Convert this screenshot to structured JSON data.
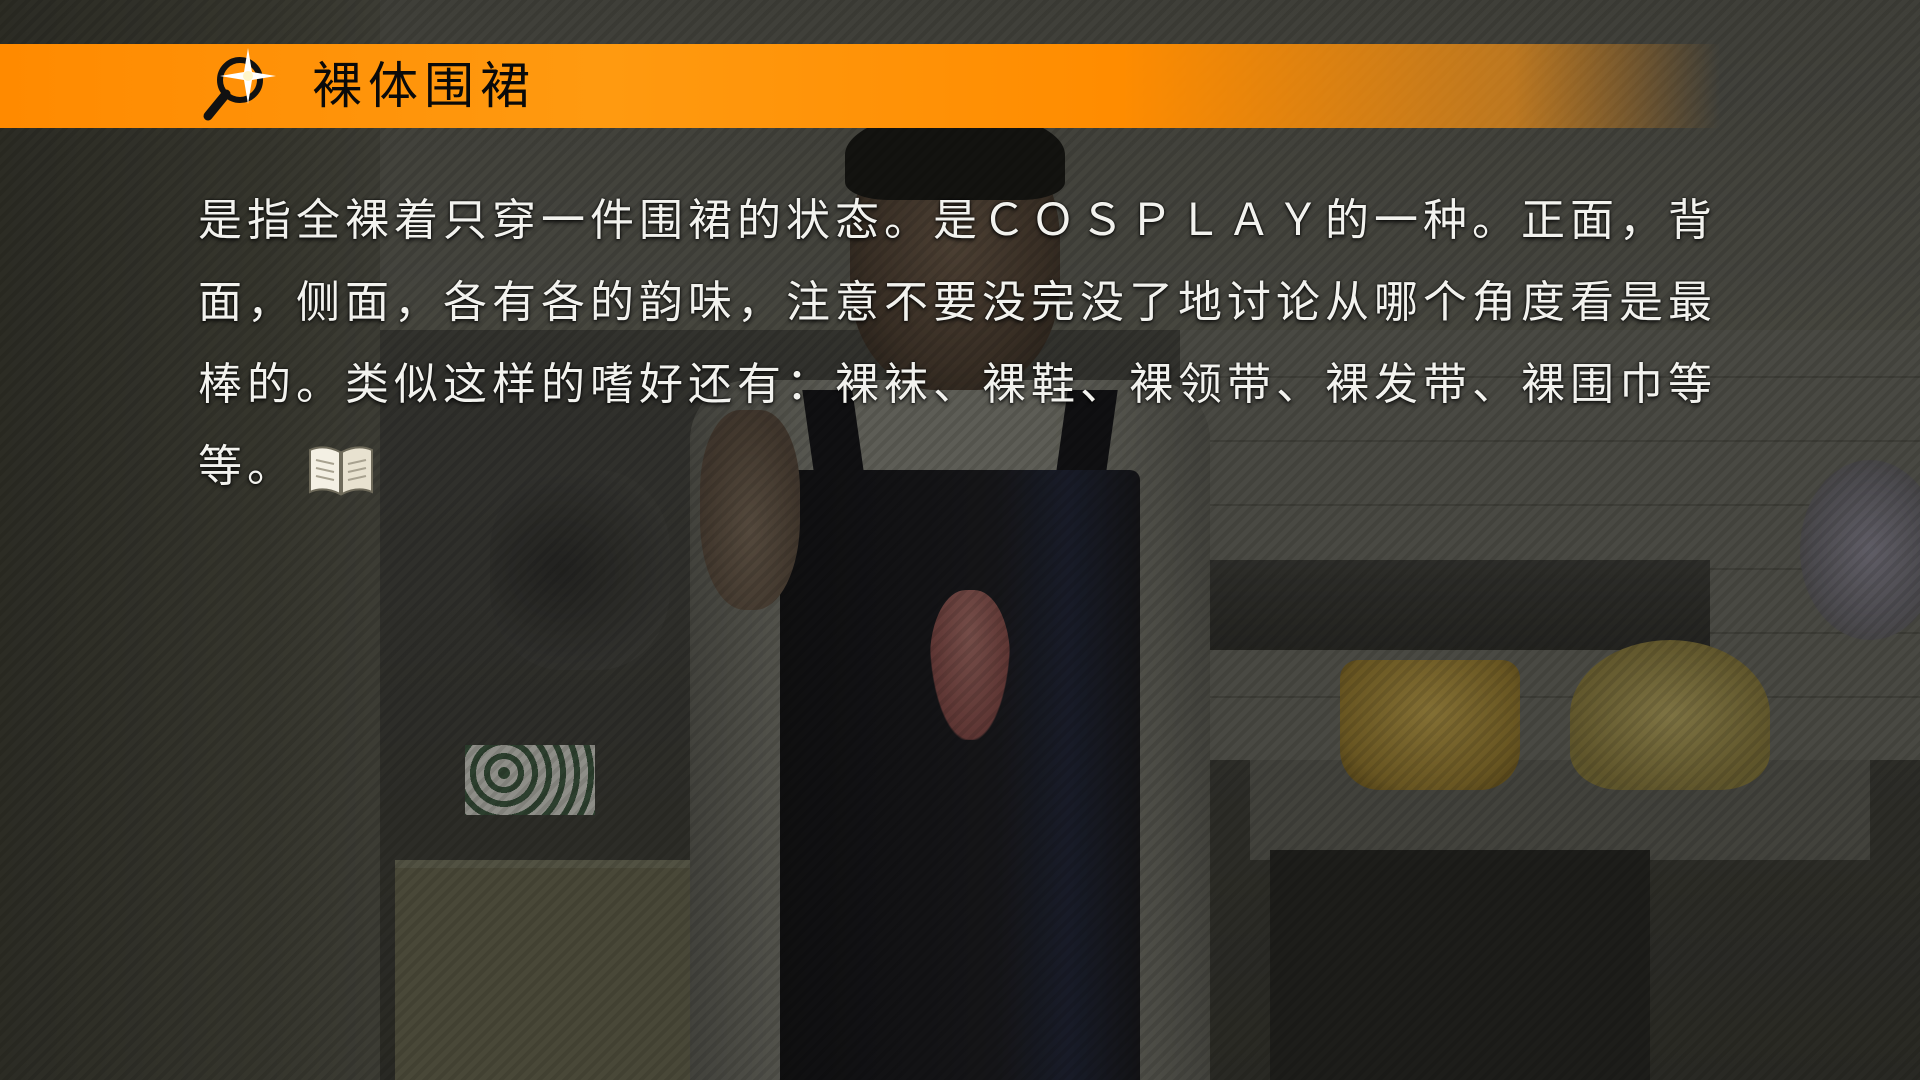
{
  "entry": {
    "title": "裸体围裙",
    "description": "是指全裸着只穿一件围裙的状态。是ＣＯＳＰＬＡＹ的一种。正面，背面，侧面，各有各的韵味，注意不要没完没了地讨论从哪个角度看是最棒的。类似这样的嗜好还有：裸袜、裸鞋、裸领带、裸发带、裸围巾等等。"
  },
  "icons": {
    "search": "magnifier-sparkle-icon",
    "book": "open-book-icon"
  },
  "colors": {
    "banner": "#ff8a00",
    "title_text": "#0a0a0a",
    "body_text": "#f2f2ee"
  }
}
